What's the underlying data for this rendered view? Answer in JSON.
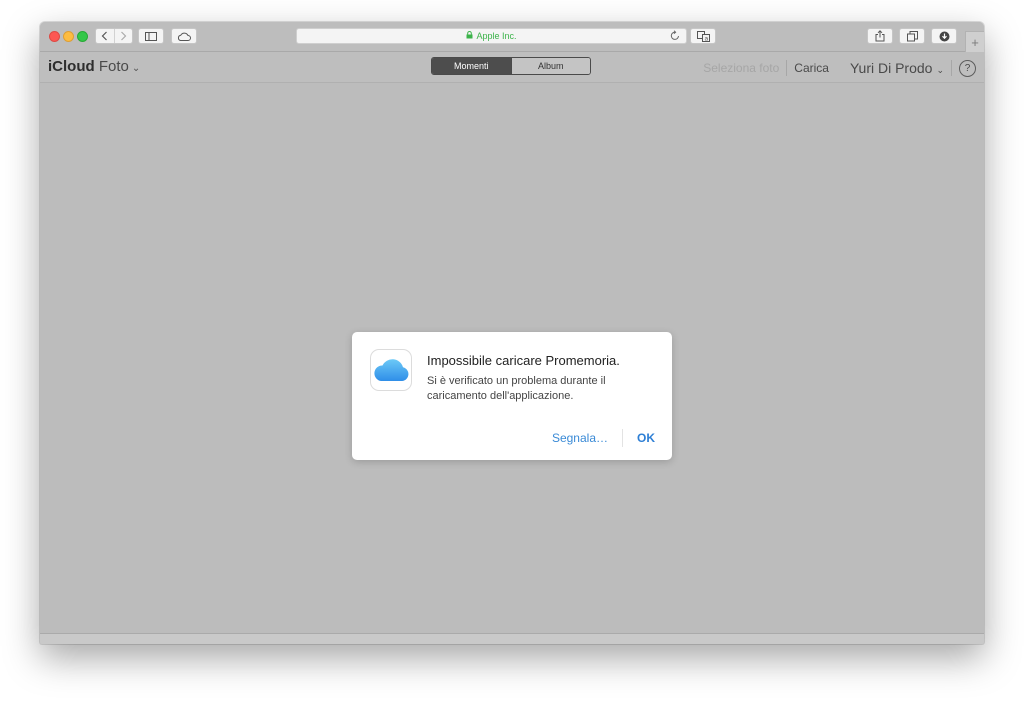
{
  "browser": {
    "address_text": "Apple Inc.",
    "accent_secure": "#3cb34a"
  },
  "app": {
    "brand_bold": "iCloud",
    "brand_light": "Foto",
    "tabs": [
      {
        "label": "Momenti",
        "active": true
      },
      {
        "label": "Album",
        "active": false
      }
    ],
    "select_label": "Seleziona foto",
    "upload_label": "Carica",
    "user_name": "Yuri Di Prodo",
    "help_label": "?"
  },
  "dialog": {
    "title": "Impossibile caricare Promemoria.",
    "message": "Si è verificato un problema durante il caricamento dell'applicazione.",
    "report_label": "Segnala…",
    "ok_label": "OK",
    "icon": "icloud-icon"
  }
}
